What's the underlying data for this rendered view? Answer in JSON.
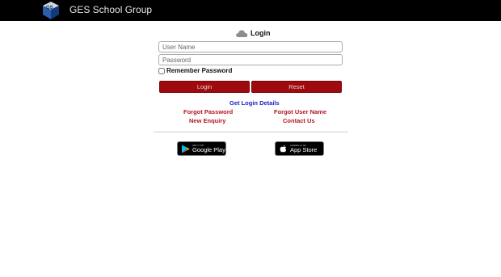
{
  "header": {
    "title": "GES School Group",
    "logo_icon": "ges-logo-icon"
  },
  "login": {
    "icon": "cloud-icon",
    "title": "Login",
    "username_placeholder": "User Name",
    "username_value": "",
    "password_placeholder": "Password",
    "password_value": "",
    "remember_label": "Remember Password",
    "remember_checked": false,
    "login_button": "Login",
    "reset_button": "Reset"
  },
  "links": {
    "get_login_details": "Get Login Details",
    "forgot_password": "Forgot Password",
    "forgot_username": "Forgot User Name",
    "new_enquiry": "New Enquiry",
    "contact_us": "Contact Us"
  },
  "stores": {
    "google": {
      "small": "GET IT ON",
      "big": "Google Play",
      "icon": "google-play-icon"
    },
    "apple": {
      "small": "Available on the",
      "big": "App Store",
      "icon": "apple-icon"
    }
  },
  "colors": {
    "header_bg": "#000000",
    "button_bg": "#9e0b0f",
    "link_red": "#b51420",
    "link_blue": "#1a22c8"
  }
}
